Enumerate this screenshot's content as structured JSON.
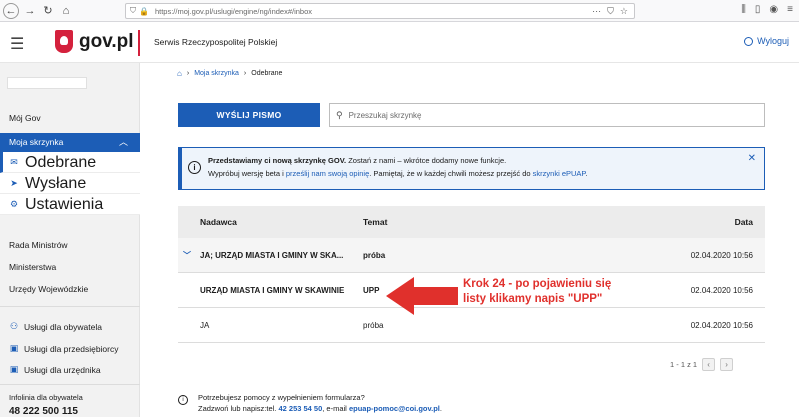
{
  "browser": {
    "url": "https://moj.gov.pl/uslugi/engine/ng/index#/inbox"
  },
  "header": {
    "logo": "gov.pl",
    "service": "Serwis Rzeczypospolitej Polskiej",
    "logout": "Wyloguj"
  },
  "sidebar": {
    "moj_gov": "Mój Gov",
    "moja_skrzynka": "Moja skrzynka",
    "sub": [
      "Odebrane",
      "Wysłane",
      "Ustawienia"
    ],
    "links1": [
      "Rada Ministrów",
      "Ministerstwa",
      "Urzędy Wojewódzkie"
    ],
    "links2": [
      "Usługi dla obywatela",
      "Usługi dla przedsiębiorcy",
      "Usługi dla urzędnika"
    ],
    "infolinia": "Infolinia dla obywatela",
    "phone": "48 222 500 115"
  },
  "breadcrumb": {
    "moja_skrzynka": "Moja skrzynka",
    "odebrane": "Odebrane"
  },
  "toolbar": {
    "send": "WYŚLIJ PISMO",
    "search_placeholder": "Przeszukaj skrzynkę"
  },
  "info": {
    "bold": "Przedstawiamy ci nową skrzynkę GOV.",
    "line1_rest": " Zostań z nami – wkrótce dodamy nowe funkcje.",
    "line2_a": "Wypróbuj wersję beta i ",
    "line2_link1": "prześlij nam swoją opinię",
    "line2_b": ". Pamiętaj, że w każdej chwili możesz przejść do ",
    "line2_link2": "skrzynki ePUAP",
    "line2_c": "."
  },
  "table": {
    "headers": [
      "Nadawca",
      "Temat",
      "Data"
    ],
    "rows": [
      {
        "sender": "JA; URZĄD MIASTA I GMINY W SKA...",
        "subject": "próba",
        "date": "02.04.2020 10:56"
      },
      {
        "sender": "URZĄD MIASTA I GMINY W SKAWINIE",
        "subject": "UPP",
        "date": "02.04.2020 10:56"
      },
      {
        "sender": "JA",
        "subject": "próba",
        "date": "02.04.2020 10:56"
      }
    ]
  },
  "pager": {
    "text": "1 - 1 z 1"
  },
  "help": {
    "line1": "Potrzebujesz pomocy z wypełnieniem formularza?",
    "line2_a": "Zadzwoń lub napisz:tel. ",
    "phone": "42 253 54 50",
    "line2_b": ", e-mail ",
    "email": "epuap-pomoc@coi.gov.pl",
    "line2_c": "."
  },
  "annotation": {
    "text": "Krok 24 - po pojawieniu się listy klikamy napis \"UPP\"",
    "color": "#e0302c"
  },
  "colors": {
    "accent": "#1c5db6",
    "brand_red": "#d4213d"
  }
}
